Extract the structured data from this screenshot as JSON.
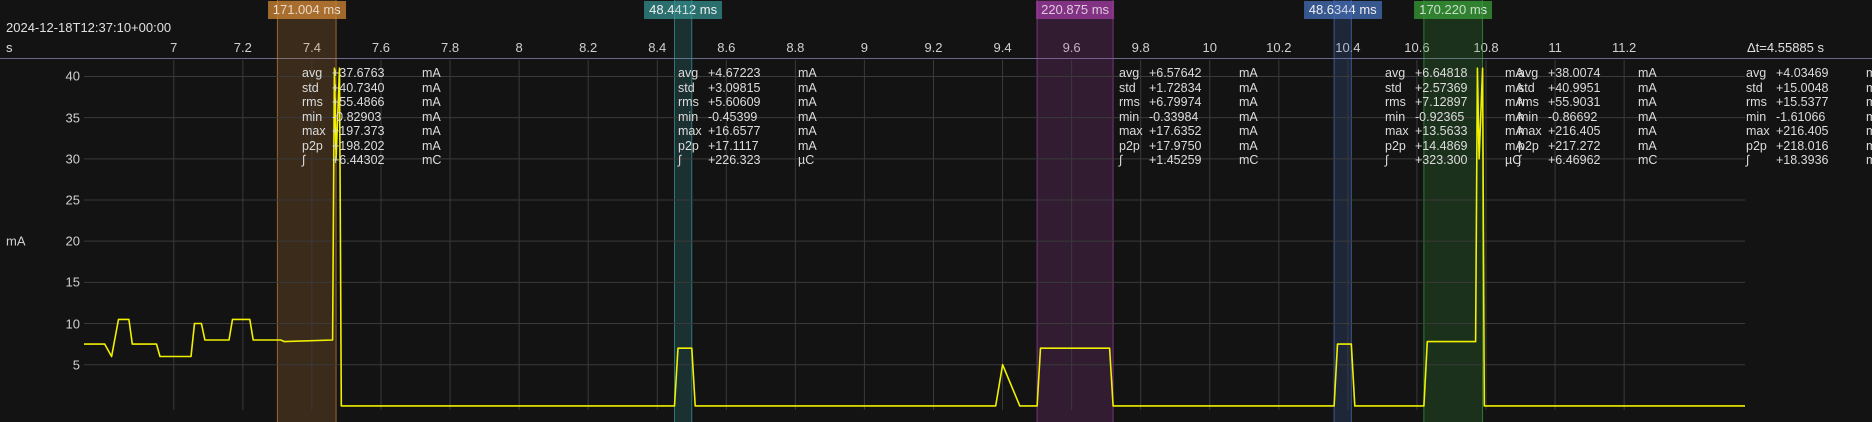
{
  "header": {
    "timestamp": "2024-12-18T12:37:10+00:00",
    "x_unit": "s",
    "delta_total": "Δt=4.55885 s"
  },
  "x_ticks": [
    {
      "value": 7,
      "label": "7"
    },
    {
      "value": 7.2,
      "label": "7.2"
    },
    {
      "value": 7.4,
      "label": "7.4"
    },
    {
      "value": 7.6,
      "label": "7.6"
    },
    {
      "value": 7.8,
      "label": "7.8"
    },
    {
      "value": 8,
      "label": "8"
    },
    {
      "value": 8.2,
      "label": "8.2"
    },
    {
      "value": 8.4,
      "label": "8.4"
    },
    {
      "value": 8.6,
      "label": "8.6"
    },
    {
      "value": 8.8,
      "label": "8.8"
    },
    {
      "value": 9,
      "label": "9"
    },
    {
      "value": 9.2,
      "label": "9.2"
    },
    {
      "value": 9.4,
      "label": "9.4"
    },
    {
      "value": 9.6,
      "label": "9.6"
    },
    {
      "value": 9.8,
      "label": "9.8"
    },
    {
      "value": 10,
      "label": "10"
    },
    {
      "value": 10.2,
      "label": "10.2"
    },
    {
      "value": 10.4,
      "label": "10.4"
    },
    {
      "value": 10.6,
      "label": "10.6"
    },
    {
      "value": 10.8,
      "label": "10.8"
    },
    {
      "value": 11,
      "label": "11"
    },
    {
      "value": 11.2,
      "label": "11.2"
    }
  ],
  "y_axis": {
    "unit": "mA",
    "ticks": [
      5,
      10,
      15,
      20,
      25,
      30,
      35,
      40
    ]
  },
  "markers": [
    {
      "label": "171.004 ms",
      "start": 7.3,
      "end": 7.47,
      "color": "#c8843a",
      "label_bg": "#a0682a"
    },
    {
      "label": "48.4412 ms",
      "start": 8.45,
      "end": 8.5,
      "color": "#3a9a9a",
      "label_bg": "#2a6e6e"
    },
    {
      "label": "220.875 ms",
      "start": 9.5,
      "end": 9.72,
      "color": "#a040a0",
      "label_bg": "#7a2f7a"
    },
    {
      "label": "48.6344 ms",
      "start": 10.36,
      "end": 10.41,
      "color": "#4a70c0",
      "label_bg": "#37578f"
    },
    {
      "label": "170.220 ms",
      "start": 10.62,
      "end": 10.79,
      "color": "#3aa03a",
      "label_bg": "#2d7a2d"
    }
  ],
  "stats": [
    {
      "avg": "+37.6763",
      "avg_u": "mA",
      "std": "+40.7340",
      "std_u": "mA",
      "rms": "+55.4866",
      "rms_u": "mA",
      "min": "-0.82903",
      "min_u": "mA",
      "max": "+197.373",
      "max_u": "mA",
      "p2p": "+198.202",
      "p2p_u": "mA",
      "int": "+6.44302",
      "int_u": "mC"
    },
    {
      "avg": "+4.67223",
      "avg_u": "mA",
      "std": "+3.09815",
      "std_u": "mA",
      "rms": "+5.60609",
      "rms_u": "mA",
      "min": "-0.45399",
      "min_u": "mA",
      "max": "+16.6577",
      "max_u": "mA",
      "p2p": "+17.1117",
      "p2p_u": "mA",
      "int": "+226.323",
      "int_u": "µC"
    },
    {
      "avg": "+6.57642",
      "avg_u": "mA",
      "std": "+1.72834",
      "std_u": "mA",
      "rms": "+6.79974",
      "rms_u": "mA",
      "min": "-0.33984",
      "min_u": "mA",
      "max": "+17.6352",
      "max_u": "mA",
      "p2p": "+17.9750",
      "p2p_u": "mA",
      "int": "+1.45259",
      "int_u": "mC"
    },
    {
      "avg": "+6.64818",
      "avg_u": "mA",
      "std": "+2.57369",
      "std_u": "mA",
      "rms": "+7.12897",
      "rms_u": "mA",
      "min": "-0.92365",
      "min_u": "mA",
      "max": "+13.5633",
      "max_u": "mA",
      "p2p": "+14.4869",
      "p2p_u": "mA",
      "int": "+323.300",
      "int_u": "µC"
    },
    {
      "avg": "+38.0074",
      "avg_u": "mA",
      "std": "+40.9951",
      "std_u": "mA",
      "rms": "+55.9031",
      "rms_u": "mA",
      "min": "-0.86692",
      "min_u": "mA",
      "max": "+216.405",
      "max_u": "mA",
      "p2p": "+217.272",
      "p2p_u": "mA",
      "int": "+6.46962",
      "int_u": "mC"
    },
    {
      "avg": "+4.03469",
      "avg_u": "mA",
      "std": "+15.0048",
      "std_u": "mA",
      "rms": "+15.5377",
      "rms_u": "mA",
      "min": "-1.61066",
      "min_u": "mA",
      "max": "+216.405",
      "max_u": "mA",
      "p2p": "+218.016",
      "p2p_u": "mA",
      "int": "+18.3936",
      "int_u": "mC"
    }
  ],
  "stat_keys": [
    "avg",
    "std",
    "rms",
    "min",
    "max",
    "p2p",
    "∫"
  ],
  "colors": {
    "trace": "#f0f000",
    "background": "#131313",
    "grid": "#3a3a3a"
  },
  "chart_data": {
    "type": "line",
    "xlabel": "s",
    "ylabel": "mA",
    "xlim": [
      6.74,
      11.55
    ],
    "ylim": [
      -0.5,
      42
    ],
    "series": [
      {
        "x": [
          6.74,
          6.8,
          6.82,
          6.84,
          6.87,
          6.88,
          6.95,
          6.96,
          7.05,
          7.06,
          7.08,
          7.09,
          7.16,
          7.17,
          7.22,
          7.23,
          7.31,
          7.32,
          7.46,
          7.465,
          7.47,
          7.48,
          7.485,
          7.49,
          7.55,
          8.4,
          8.45,
          8.46,
          8.5,
          8.51,
          8.52,
          9.36,
          9.38,
          9.4,
          9.45,
          9.5,
          9.51,
          9.71,
          9.72,
          9.73,
          10.36,
          10.37,
          10.41,
          10.42,
          10.43,
          10.62,
          10.63,
          10.77,
          10.775,
          10.78,
          10.79,
          10.795,
          10.8,
          10.82,
          11.55
        ],
        "y": [
          7.5,
          7.5,
          6,
          10.5,
          10.5,
          7.5,
          7.5,
          6,
          6,
          10,
          10,
          8,
          8,
          10.5,
          10.5,
          8,
          8,
          7.8,
          8,
          41,
          30,
          41,
          0,
          0,
          0,
          0,
          0,
          7,
          7,
          0,
          0,
          0,
          0,
          5,
          0,
          0,
          7,
          7,
          0,
          0,
          0,
          7.5,
          7.5,
          0,
          0,
          0,
          7.8,
          7.8,
          41,
          30,
          41,
          0,
          0,
          0,
          0
        ]
      }
    ]
  }
}
